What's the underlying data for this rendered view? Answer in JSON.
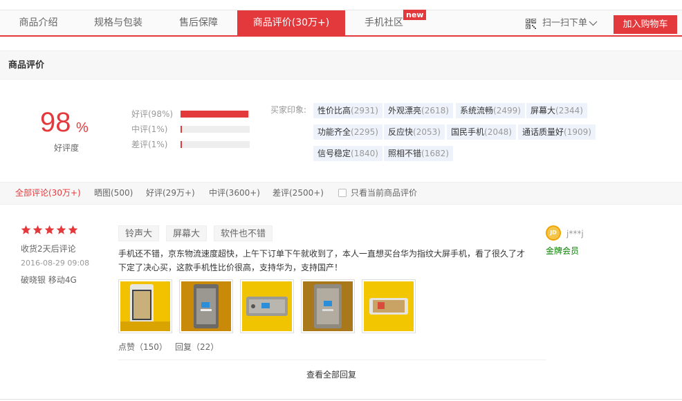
{
  "tabs": [
    {
      "label": "商品介绍"
    },
    {
      "label": "规格与包装"
    },
    {
      "label": "售后保障"
    },
    {
      "label": "商品评价(30万+)"
    },
    {
      "label": "手机社区"
    }
  ],
  "new_badge": "new",
  "scan_label": "扫一扫下单",
  "cart_label": "加入购物车",
  "section_title": "商品评价",
  "rate": {
    "value": "98",
    "unit": "%",
    "label": "好评度"
  },
  "rate_bars": [
    {
      "label": "好评(98%)",
      "percent": 98
    },
    {
      "label": "中评(1%)",
      "percent": 1
    },
    {
      "label": "差评(1%)",
      "percent": 1
    }
  ],
  "impression_label": "买家印象:",
  "impressions": [
    {
      "text": "性价比高",
      "count": "(2931)"
    },
    {
      "text": "外观漂亮",
      "count": "(2618)"
    },
    {
      "text": "系统流畅",
      "count": "(2499)"
    },
    {
      "text": "屏幕大",
      "count": "(2344)"
    },
    {
      "text": "功能齐全",
      "count": "(2295)"
    },
    {
      "text": "反应快",
      "count": "(2053)"
    },
    {
      "text": "国民手机",
      "count": "(2048)"
    },
    {
      "text": "通话质量好",
      "count": "(1909)"
    },
    {
      "text": "信号稳定",
      "count": "(1840)"
    },
    {
      "text": "照相不错",
      "count": "(1682)"
    }
  ],
  "filters": [
    {
      "label": "全部评论(30万+)"
    },
    {
      "label": "晒图(500)"
    },
    {
      "label": "好评(29万+)"
    },
    {
      "label": "中评(3600+)"
    },
    {
      "label": "差评(2500+)"
    }
  ],
  "only_current_label": "只看当前商品评价",
  "review": {
    "stars": 5,
    "receipt": "收货2天后评论",
    "date": "2016-08-29 09:08",
    "variant": "破晓银  移动4G",
    "tags": [
      "铃声大",
      "屏幕大",
      "软件也不错"
    ],
    "content": "手机还不错，京东物流速度超快，上午下订单下午就收到了，本人一直想买台华为指纹大屏手机，看了很久了才下定了决心买，这款手机性比价很高，支持华为，支持国产！",
    "likes": "点赞（150）",
    "replies": "回复（22）",
    "view_all": "查看全部回复",
    "user": "j***j",
    "avatar_text": "JD",
    "member_level": "金牌会员"
  },
  "colors": {
    "accent": "#e4393c",
    "tag_bg": "#eef3fb",
    "gold_member": "#088000"
  }
}
